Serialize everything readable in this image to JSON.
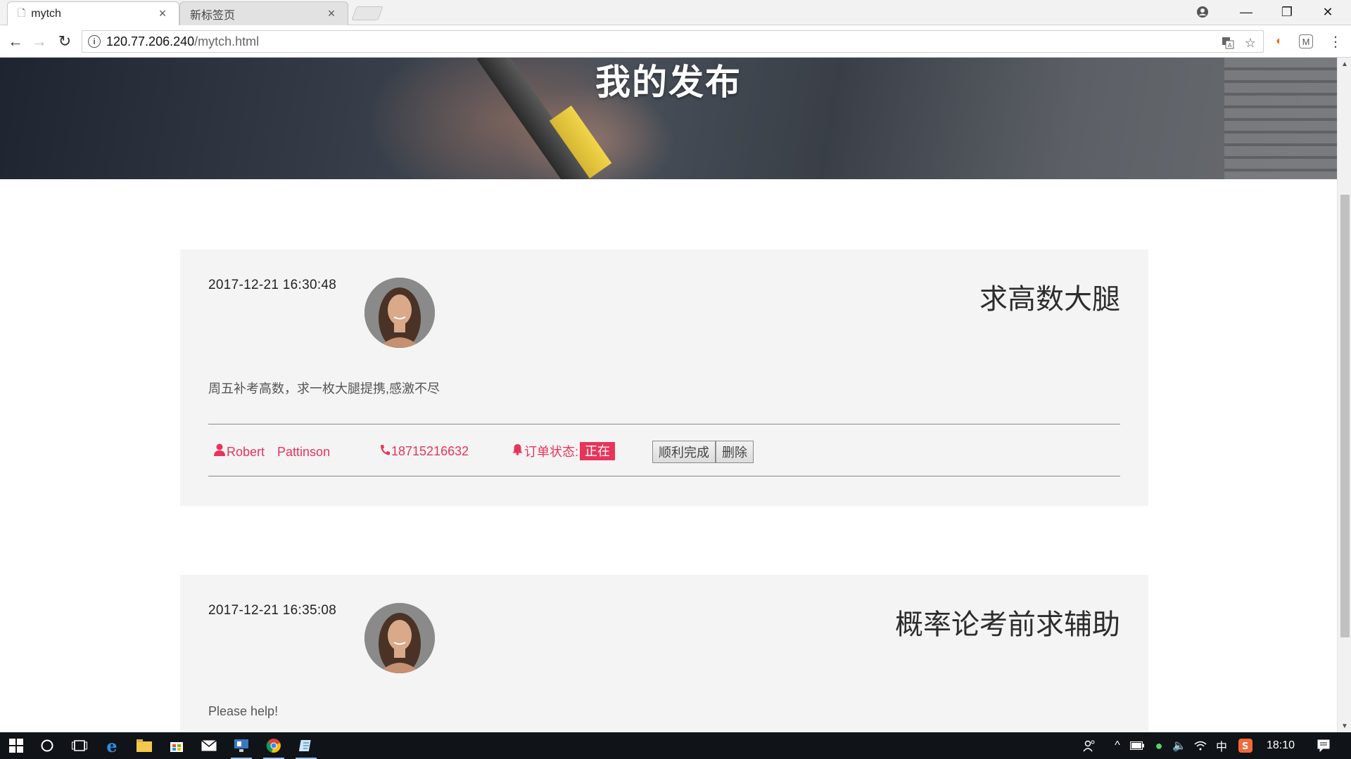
{
  "browser": {
    "tabs": [
      {
        "title": "mytch",
        "close": "×"
      },
      {
        "title": "新标签页",
        "close": "×"
      }
    ],
    "url_host": "120.77.206.240",
    "url_path": "/mytch.html",
    "window_controls": {
      "minimize": "—",
      "restore": "❐",
      "close": "✕"
    }
  },
  "hero": {
    "title": "我的发布"
  },
  "posts": [
    {
      "time": "2017-12-21 16:30:48",
      "title": "求高数大腿",
      "description": "周五补考高数，求一枚大腿提携,感激不尽",
      "user": "Robert　Pattinson",
      "phone": "18715216632",
      "status_label": "订单状态:",
      "status_value": "正在",
      "done_button": "顺利完成",
      "delete_button": "删除"
    },
    {
      "time": "2017-12-21 16:35:08",
      "title": "概率论考前求辅助",
      "description": "Please help!"
    }
  ],
  "taskbar": {
    "ime": "中",
    "clock": "18:10"
  },
  "colors": {
    "accent": "#e8345a",
    "card_bg": "#f4f4f4"
  }
}
